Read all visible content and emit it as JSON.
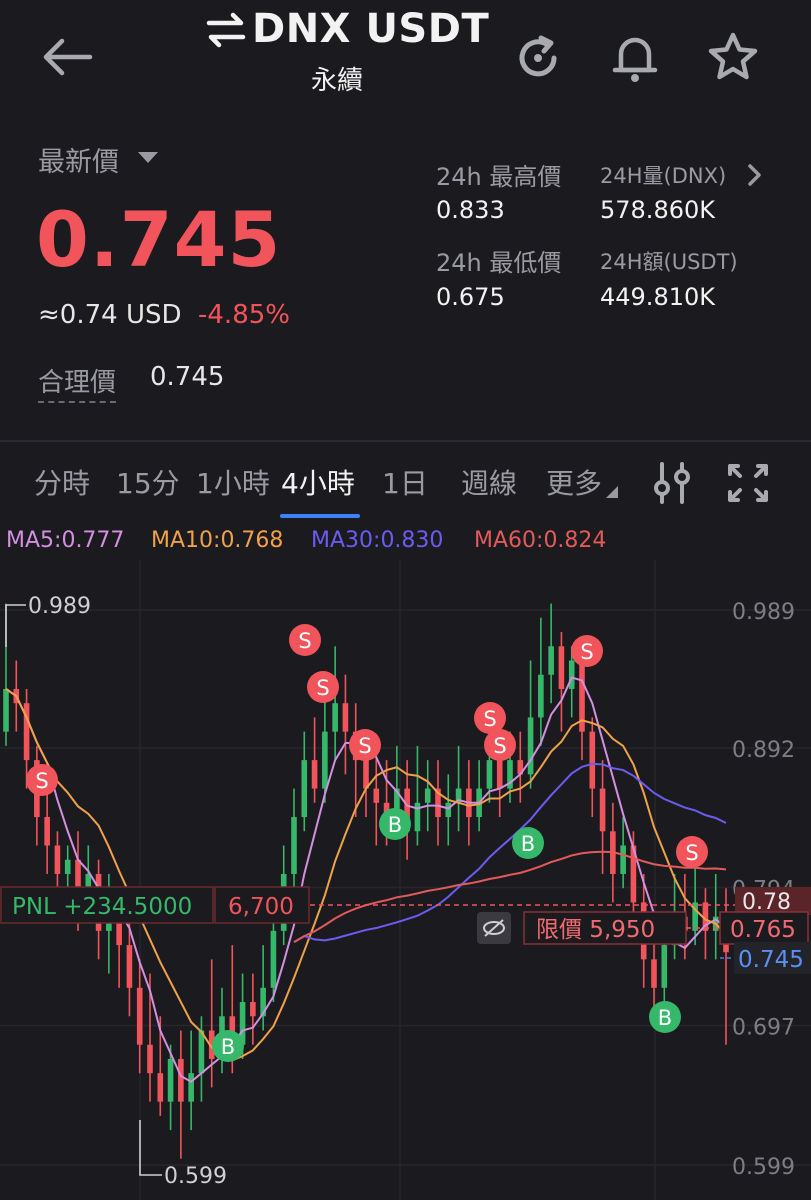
{
  "header": {
    "title": "DNX USDT",
    "subtitle": "永續"
  },
  "price": {
    "label": "最新價",
    "last": "0.745",
    "usd": "≈0.74 USD",
    "change": "-4.85%",
    "fair_label": "合理價",
    "fair_value": "0.745"
  },
  "stats": {
    "high_label": "24h 最高價",
    "high_value": "0.833",
    "low_label": "24h 最低價",
    "low_value": "0.675",
    "vol_label": "24H量(DNX)",
    "vol_value": "578.860K",
    "amt_label": "24H額(USDT)",
    "amt_value": "449.810K"
  },
  "tabs": [
    {
      "label": "分時"
    },
    {
      "label": "15分"
    },
    {
      "label": "1小時"
    },
    {
      "label": "4小時",
      "active": true
    },
    {
      "label": "1日"
    },
    {
      "label": "週線"
    },
    {
      "label": "更多"
    }
  ],
  "ma": [
    {
      "label": "MA5:0.777",
      "color": "#d48fe0"
    },
    {
      "label": "MA10:0.768",
      "color": "#f0a14a"
    },
    {
      "label": "MA30:0.830",
      "color": "#6b5cf0"
    },
    {
      "label": "MA60:0.824",
      "color": "#e25a5a"
    }
  ],
  "colors": {
    "up": "#35b86a",
    "down": "#f2545b",
    "bg": "#1b1b1f",
    "accent": "#3b82f6"
  },
  "chart_data": {
    "type": "candlestick",
    "y_ticks": [
      "0.989",
      "0.892",
      "0.794",
      "0.697",
      "0.599"
    ],
    "ylim": [
      0.58,
      1.01
    ],
    "high_mark": "0.989",
    "low_mark": "0.599",
    "pnl_label": "PNL +234.5000",
    "position_size": "6,700",
    "limit_label": "限價 5,950",
    "limit_price": "0.765",
    "current_price": "0.745",
    "right_edge_label": "0.78",
    "candles": [
      [
        0.9,
        0.93,
        0.89,
        0.99
      ],
      [
        0.93,
        0.92,
        0.9,
        0.95
      ],
      [
        0.92,
        0.88,
        0.86,
        0.93
      ],
      [
        0.88,
        0.84,
        0.82,
        0.89
      ],
      [
        0.84,
        0.82,
        0.8,
        0.86
      ],
      [
        0.82,
        0.8,
        0.78,
        0.83
      ],
      [
        0.8,
        0.81,
        0.78,
        0.82
      ],
      [
        0.81,
        0.78,
        0.76,
        0.83
      ],
      [
        0.78,
        0.8,
        0.77,
        0.82
      ],
      [
        0.8,
        0.76,
        0.74,
        0.81
      ],
      [
        0.76,
        0.78,
        0.73,
        0.8
      ],
      [
        0.78,
        0.75,
        0.72,
        0.79
      ],
      [
        0.75,
        0.72,
        0.7,
        0.77
      ],
      [
        0.72,
        0.68,
        0.66,
        0.74
      ],
      [
        0.68,
        0.66,
        0.64,
        0.73
      ],
      [
        0.66,
        0.64,
        0.63,
        0.7
      ],
      [
        0.64,
        0.67,
        0.62,
        0.68
      ],
      [
        0.67,
        0.64,
        0.6,
        0.69
      ],
      [
        0.64,
        0.66,
        0.62,
        0.69
      ],
      [
        0.66,
        0.69,
        0.64,
        0.7
      ],
      [
        0.69,
        0.67,
        0.65,
        0.74
      ],
      [
        0.67,
        0.7,
        0.66,
        0.72
      ],
      [
        0.7,
        0.68,
        0.66,
        0.75
      ],
      [
        0.68,
        0.71,
        0.67,
        0.73
      ],
      [
        0.71,
        0.7,
        0.68,
        0.73
      ],
      [
        0.7,
        0.72,
        0.69,
        0.75
      ],
      [
        0.72,
        0.76,
        0.71,
        0.78
      ],
      [
        0.76,
        0.8,
        0.75,
        0.82
      ],
      [
        0.8,
        0.84,
        0.79,
        0.86
      ],
      [
        0.84,
        0.88,
        0.83,
        0.9
      ],
      [
        0.88,
        0.86,
        0.85,
        0.91
      ],
      [
        0.86,
        0.9,
        0.85,
        0.94
      ],
      [
        0.9,
        0.92,
        0.88,
        0.96
      ],
      [
        0.92,
        0.9,
        0.87,
        0.94
      ],
      [
        0.9,
        0.88,
        0.84,
        0.92
      ],
      [
        0.88,
        0.86,
        0.84,
        0.9
      ],
      [
        0.86,
        0.85,
        0.82,
        0.89
      ],
      [
        0.85,
        0.84,
        0.82,
        0.88
      ],
      [
        0.84,
        0.86,
        0.83,
        0.89
      ],
      [
        0.86,
        0.83,
        0.81,
        0.88
      ],
      [
        0.83,
        0.85,
        0.82,
        0.89
      ],
      [
        0.85,
        0.86,
        0.83,
        0.88
      ],
      [
        0.86,
        0.84,
        0.82,
        0.88
      ],
      [
        0.84,
        0.85,
        0.82,
        0.87
      ],
      [
        0.85,
        0.86,
        0.83,
        0.89
      ],
      [
        0.86,
        0.84,
        0.82,
        0.88
      ],
      [
        0.84,
        0.86,
        0.83,
        0.88
      ],
      [
        0.86,
        0.88,
        0.85,
        0.9
      ],
      [
        0.88,
        0.86,
        0.84,
        0.91
      ],
      [
        0.86,
        0.88,
        0.85,
        0.9
      ],
      [
        0.88,
        0.87,
        0.85,
        0.9
      ],
      [
        0.87,
        0.91,
        0.86,
        0.95
      ],
      [
        0.91,
        0.94,
        0.89,
        0.98
      ],
      [
        0.94,
        0.96,
        0.92,
        0.99
      ],
      [
        0.96,
        0.93,
        0.9,
        0.97
      ],
      [
        0.93,
        0.95,
        0.91,
        0.96
      ],
      [
        0.95,
        0.9,
        0.88,
        0.96
      ],
      [
        0.9,
        0.86,
        0.84,
        0.91
      ],
      [
        0.86,
        0.83,
        0.8,
        0.88
      ],
      [
        0.83,
        0.8,
        0.78,
        0.85
      ],
      [
        0.8,
        0.82,
        0.79,
        0.84
      ],
      [
        0.82,
        0.78,
        0.76,
        0.83
      ],
      [
        0.78,
        0.74,
        0.72,
        0.8
      ],
      [
        0.74,
        0.72,
        0.7,
        0.77
      ],
      [
        0.72,
        0.75,
        0.71,
        0.77
      ],
      [
        0.75,
        0.77,
        0.74,
        0.8
      ],
      [
        0.77,
        0.76,
        0.74,
        0.8
      ],
      [
        0.76,
        0.78,
        0.75,
        0.81
      ],
      [
        0.78,
        0.76,
        0.74,
        0.79
      ],
      [
        0.76,
        0.77,
        0.74,
        0.8
      ],
      [
        0.77,
        0.745,
        0.68,
        0.79
      ]
    ]
  }
}
